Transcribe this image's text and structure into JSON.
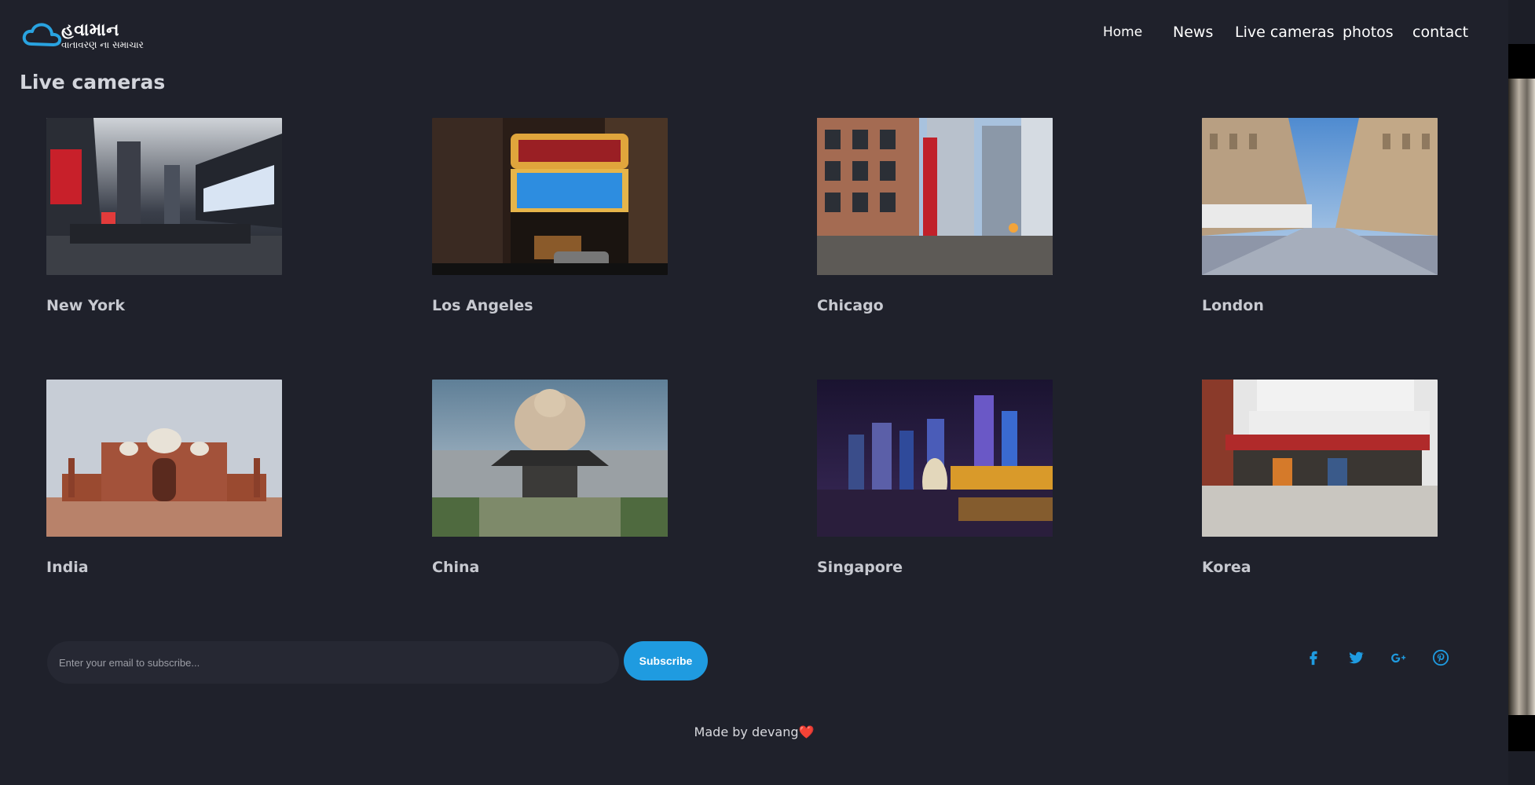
{
  "logo": {
    "title": "હવામાન",
    "subtitle": "વાતાવરણ ના સમાચાર",
    "icon": "cloud-icon",
    "color": "#29a3e0"
  },
  "nav": {
    "items": [
      {
        "label": "Home"
      },
      {
        "label": "News"
      },
      {
        "label": "Live cameras"
      },
      {
        "label": "photos"
      },
      {
        "label": "contact"
      }
    ]
  },
  "main": {
    "title": "Live cameras",
    "cameras": [
      {
        "name": "New York"
      },
      {
        "name": "Los Angeles"
      },
      {
        "name": "Chicago"
      },
      {
        "name": "London"
      },
      {
        "name": "India"
      },
      {
        "name": "China"
      },
      {
        "name": "Singapore"
      },
      {
        "name": "Korea"
      }
    ]
  },
  "subscribe": {
    "placeholder": "Enter your email to subscribe...",
    "button_label": "Subscribe",
    "accent": "#1f9be0"
  },
  "social": {
    "icons": [
      "facebook-icon",
      "twitter-icon",
      "google-plus-icon",
      "pinterest-icon"
    ],
    "color": "#1f9be0"
  },
  "footer": {
    "text": "Made by devang",
    "heart": "❤️"
  }
}
